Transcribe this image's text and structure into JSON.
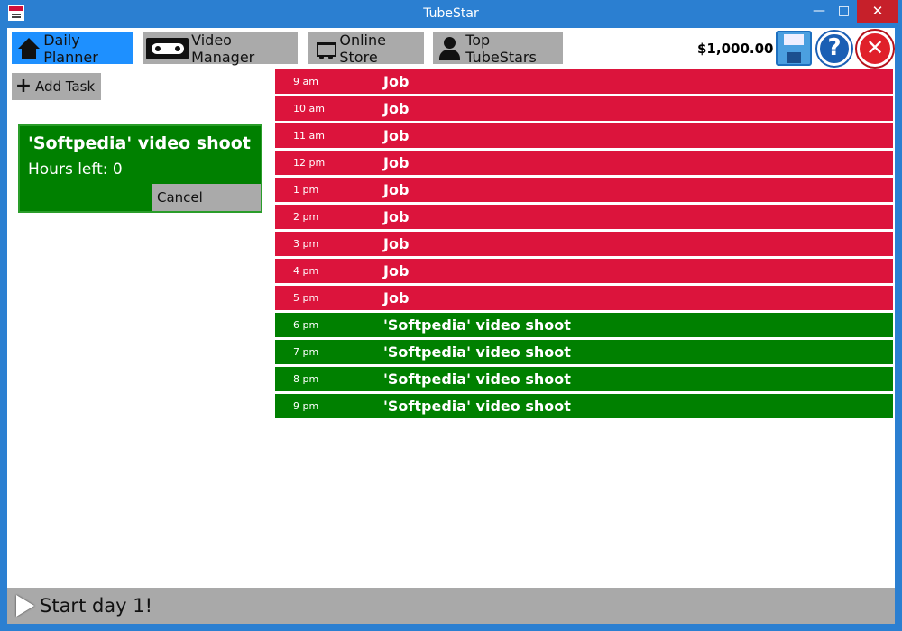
{
  "window": {
    "title": "TubeStar"
  },
  "tabs": [
    {
      "label": "Daily Planner",
      "icon": "house-icon",
      "active": true
    },
    {
      "label": "Video Manager",
      "icon": "vhs-tape-icon"
    },
    {
      "label": "Online Store",
      "icon": "shopping-cart-icon"
    },
    {
      "label": "Top TubeStars",
      "icon": "person-icon"
    }
  ],
  "header": {
    "money": "$1,000.00",
    "help_glyph": "?",
    "close_glyph": "✕"
  },
  "sidebar": {
    "add_task_label": "Add Task",
    "current_task": {
      "title": "'Softpedia' video shoot",
      "hours_left": "Hours left: 0",
      "cancel_label": "Cancel"
    }
  },
  "schedule": [
    {
      "time": "9 am",
      "label": "Job",
      "kind": "job"
    },
    {
      "time": "10 am",
      "label": "Job",
      "kind": "job"
    },
    {
      "time": "11 am",
      "label": "Job",
      "kind": "job"
    },
    {
      "time": "12 pm",
      "label": "Job",
      "kind": "job"
    },
    {
      "time": "1 pm",
      "label": "Job",
      "kind": "job"
    },
    {
      "time": "2 pm",
      "label": "Job",
      "kind": "job"
    },
    {
      "time": "3 pm",
      "label": "Job",
      "kind": "job"
    },
    {
      "time": "4 pm",
      "label": "Job",
      "kind": "job"
    },
    {
      "time": "5 pm",
      "label": "Job",
      "kind": "job"
    },
    {
      "time": "6 pm",
      "label": "'Softpedia' video shoot",
      "kind": "task"
    },
    {
      "time": "7 pm",
      "label": "'Softpedia' video shoot",
      "kind": "task"
    },
    {
      "time": "8 pm",
      "label": "'Softpedia' video shoot",
      "kind": "task"
    },
    {
      "time": "9 pm",
      "label": "'Softpedia' video shoot",
      "kind": "task"
    }
  ],
  "footer": {
    "start_label": "Start day 1!"
  },
  "colors": {
    "job": "#dc143c",
    "task": "#008000",
    "active_tab": "#1e90ff",
    "titlebar": "#2b7fd1"
  }
}
